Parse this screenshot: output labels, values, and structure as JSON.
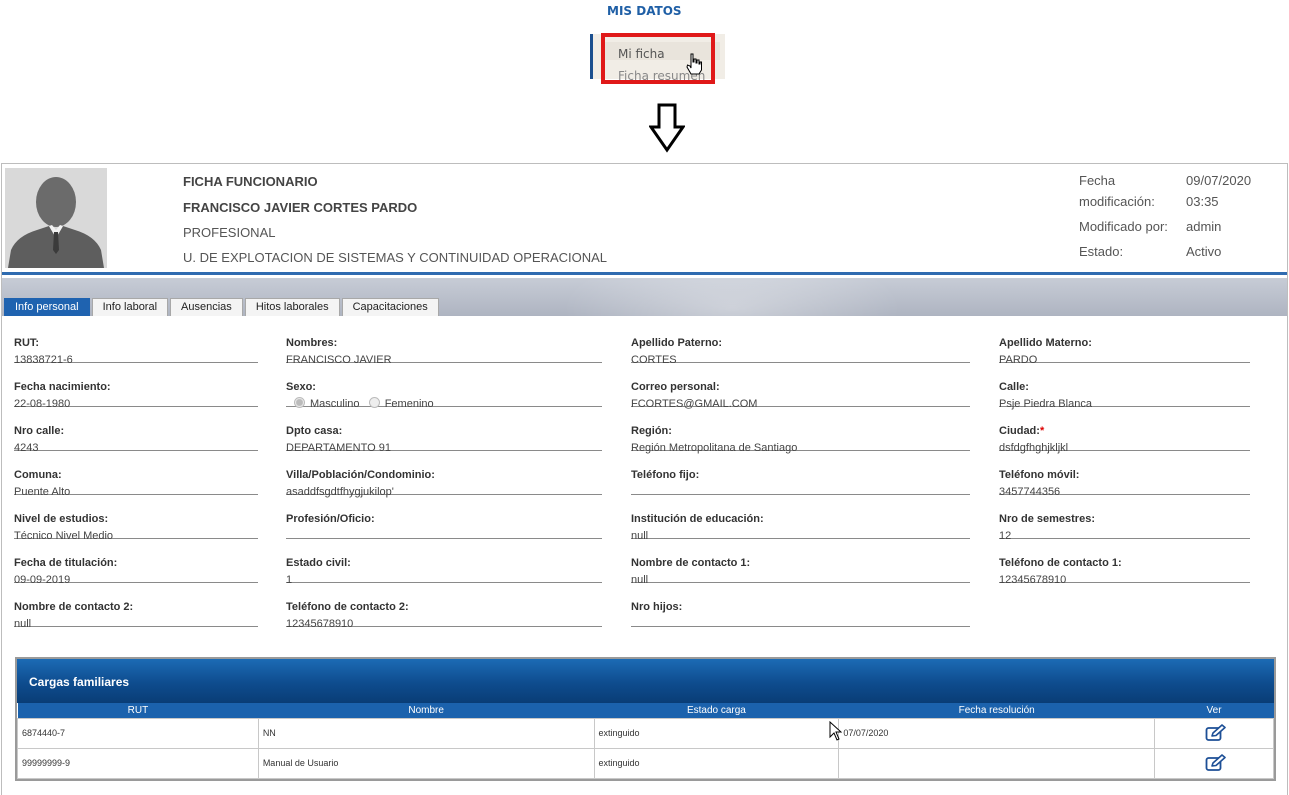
{
  "menu": {
    "mis_datos": "MIS DATOS",
    "items": [
      "Mi ficha",
      "Ficha resumen"
    ]
  },
  "header": {
    "title": "FICHA FUNCIONARIO",
    "name": "FRANCISCO JAVIER CORTES PARDO",
    "profession": "PROFESIONAL",
    "unit": "U. DE EXPLOTACION DE SISTEMAS Y CONTINUIDAD OPERACIONAL",
    "meta": {
      "fecha_label_1": "Fecha",
      "fecha_label_2": "modificación:",
      "fecha_value": "09/07/2020",
      "hora_value": "03:35",
      "modificado_label": "Modificado por:",
      "modificado_value": "admin",
      "estado_label": "Estado:",
      "estado_value": "Activo"
    }
  },
  "tabs": [
    "Info personal",
    "Info laboral",
    "Ausencias",
    "Hitos laborales",
    "Capacitaciones"
  ],
  "fields": {
    "rut": {
      "label": "RUT:",
      "value": "13838721-6"
    },
    "nombres": {
      "label": "Nombres:",
      "value": "FRANCISCO JAVIER"
    },
    "apellido_paterno": {
      "label": "Apellido Paterno:",
      "value": "CORTES"
    },
    "apellido_materno": {
      "label": "Apellido Materno:",
      "value": "PARDO"
    },
    "fecha_nacimiento": {
      "label": "Fecha nacimiento:",
      "value": "22-08-1980"
    },
    "sexo": {
      "label": "Sexo:",
      "option_1": "Masculino",
      "option_2": "Femenino"
    },
    "correo": {
      "label": "Correo personal:",
      "value": "FCORTES@GMAIL.COM"
    },
    "calle": {
      "label": "Calle:",
      "value": "Psje Piedra Blanca"
    },
    "nro_calle": {
      "label": "Nro calle:",
      "value": "4243"
    },
    "dpto": {
      "label": "Dpto casa:",
      "value": "DEPARTAMENTO 91"
    },
    "region": {
      "label": "Región:",
      "value": "Región Metropolitana de Santiago"
    },
    "ciudad": {
      "label": "Ciudad:",
      "required": "*",
      "value": "dsfdgfhghjkljkl"
    },
    "comuna": {
      "label": "Comuna:",
      "value": "Puente Alto"
    },
    "villa": {
      "label": "Villa/Población/Condominio:",
      "value": "asaddfsgdtfhygjukilop'"
    },
    "telefono_fijo": {
      "label": "Teléfono fijo:",
      "value": ""
    },
    "telefono_movil": {
      "label": "Teléfono móvil:",
      "value": "3457744356"
    },
    "nivel_estudios": {
      "label": "Nivel de estudios:",
      "value": "Técnico Nivel Medio"
    },
    "profesion": {
      "label": "Profesión/Oficio:",
      "value": ""
    },
    "institucion": {
      "label": "Institución de educación:",
      "value": "null"
    },
    "nro_semestres": {
      "label": "Nro de semestres:",
      "value": "12"
    },
    "fecha_titulacion": {
      "label": "Fecha de titulación:",
      "value": "09-09-2019"
    },
    "estado_civil": {
      "label": "Estado civil:",
      "value": "1"
    },
    "contacto_1": {
      "label": "Nombre de contacto 1:",
      "value": "null"
    },
    "telefono_contacto_1": {
      "label": "Teléfono de contacto 1:",
      "value": "12345678910"
    },
    "contacto_2": {
      "label": "Nombre de contacto 2:",
      "value": "null"
    },
    "telefono_contacto_2": {
      "label": "Teléfono de contacto 2:",
      "value": "12345678910"
    },
    "nro_hijos": {
      "label": "Nro hijos:",
      "value": ""
    }
  },
  "cargas": {
    "title": "Cargas familiares",
    "columns": [
      "RUT",
      "Nombre",
      "Estado carga",
      "Fecha resolución",
      "Ver"
    ],
    "rows": [
      {
        "rut": "6874440-7",
        "nombre": "NN",
        "estado": "extinguido",
        "fecha": "07/07/2020"
      },
      {
        "rut": "99999999-9",
        "nombre": "Manual de Usuario",
        "estado": "extinguido",
        "fecha": ""
      }
    ]
  },
  "colors": {
    "accent": "#1f63b0",
    "highlight_box": "#e01919"
  }
}
